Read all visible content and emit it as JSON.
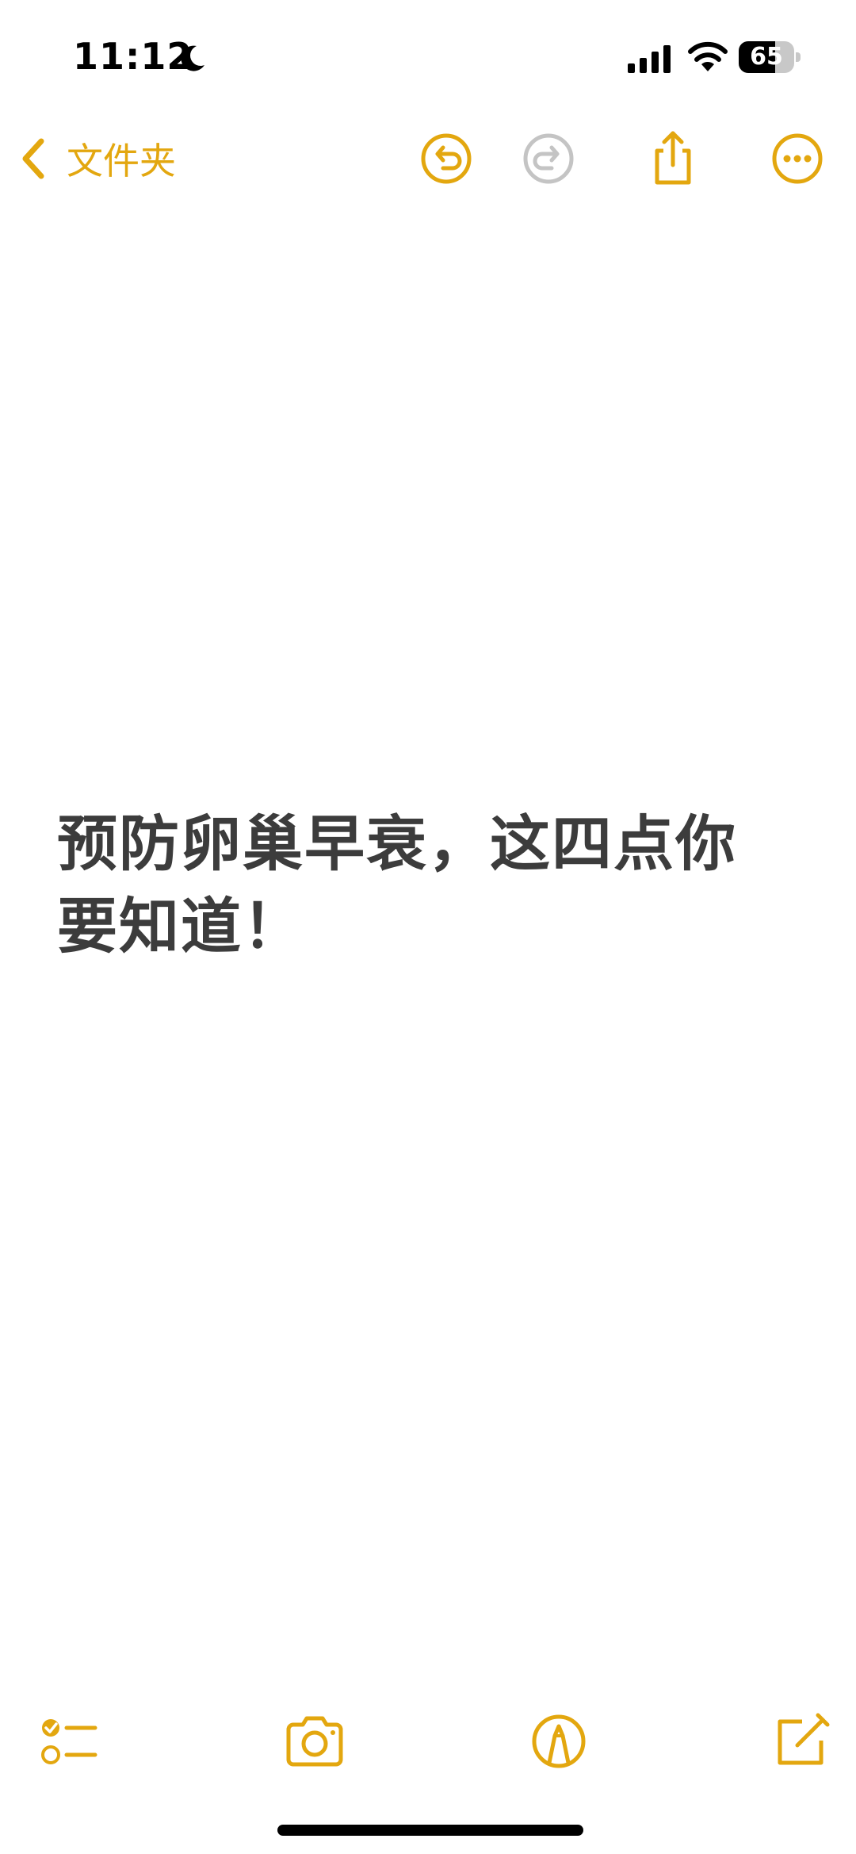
{
  "status_bar": {
    "time": "11:12",
    "battery_level": "65",
    "battery_fraction": 0.65,
    "icons": [
      "moon-icon",
      "cellular-signal-icon",
      "wifi-icon",
      "battery-icon"
    ]
  },
  "nav": {
    "back_label": "文件夹",
    "icons": [
      "chevron-left-icon",
      "undo-icon",
      "redo-icon",
      "share-icon",
      "more-icon"
    ]
  },
  "note": {
    "title": "预防卵巢早衰，这四点你要知道！"
  },
  "toolbar": {
    "icons": [
      "checklist-icon",
      "camera-icon",
      "markup-icon",
      "compose-icon"
    ]
  },
  "colors": {
    "accent": "#e3a70f",
    "disabled": "#c4c4c4",
    "text": "#3c3c3c",
    "background": "#ffffff"
  }
}
